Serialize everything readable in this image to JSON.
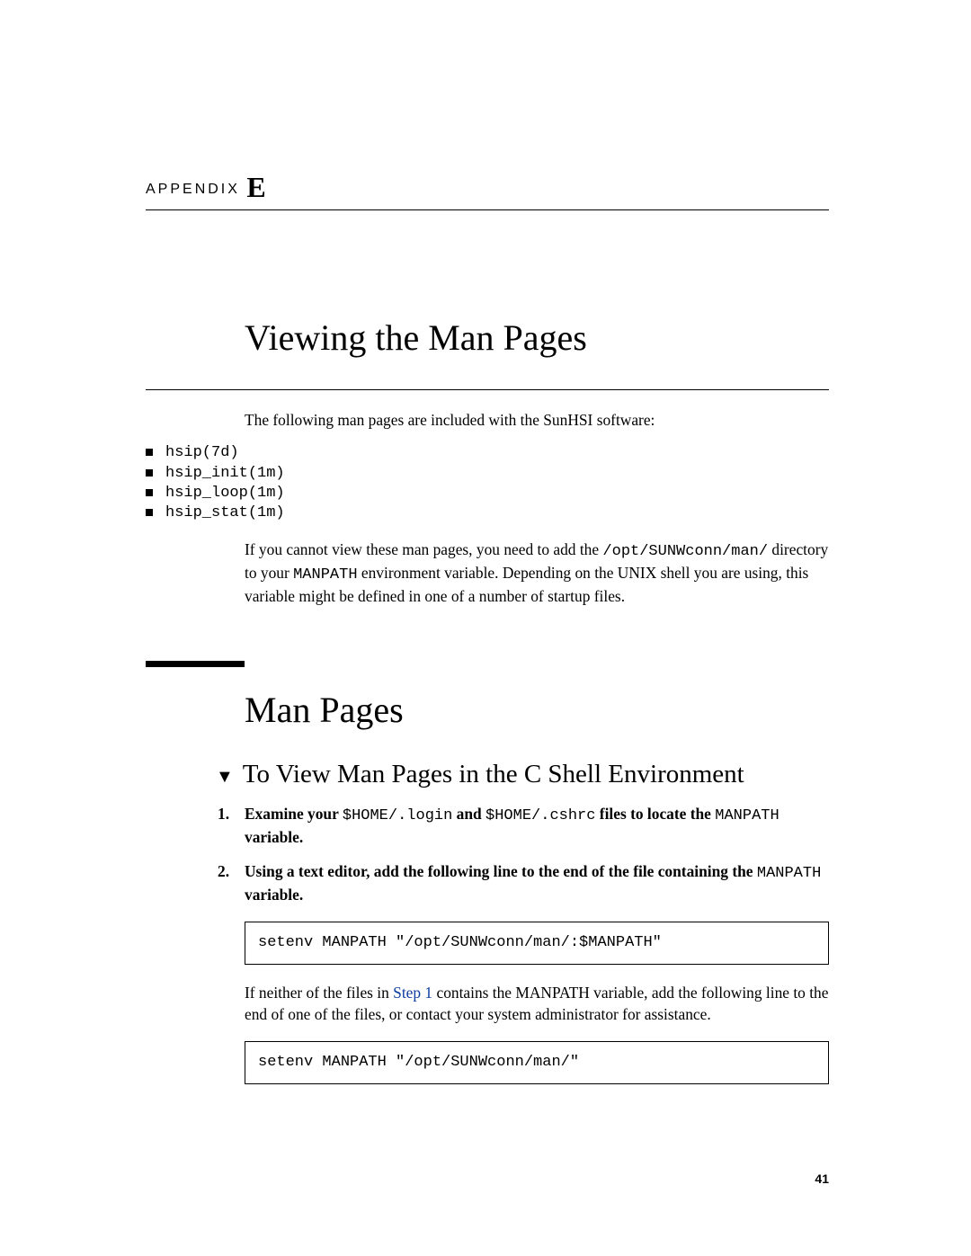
{
  "appendix": {
    "label": "APPENDIX",
    "letter": "E"
  },
  "title": "Viewing the Man Pages",
  "intro": "The following man pages are included with the SunHSI software:",
  "bullets": [
    "hsip(7d)",
    "hsip_init(1m)",
    "hsip_loop(1m)",
    "hsip_stat(1m)"
  ],
  "para2_a": "If you cannot view these man pages, you need to add the ",
  "para2_code": "/opt/SUNWconn/man/",
  "para2_b": " directory to your ",
  "para2_sc": "MANPATH",
  "para2_c": " environment variable. Depending on the UNIX shell you are using, this variable might be defined in one of a number of startup files.",
  "section": "Man Pages",
  "sub": {
    "marker": "▼",
    "title": "To View Man Pages in the C Shell Environment"
  },
  "step1": {
    "num": "1.",
    "a": "Examine your ",
    "code1": "$HOME/.login",
    "b": " and ",
    "code2": "$HOME/.cshrc",
    "c": " files to locate the ",
    "sc": "MANPATH",
    "d": " variable."
  },
  "step2": {
    "num": "2.",
    "a": "Using a text editor, add the following line to the end of the file containing the ",
    "sc": "MANPATH",
    "b": " variable."
  },
  "code1": "setenv MANPATH \"/opt/SUNWconn/man/:$MANPATH\"",
  "after": {
    "a": "If neither of the files in ",
    "link": "Step 1",
    "b": " contains the MANPATH variable, add the following line to the end of one of the files, or contact your system administrator for assistance."
  },
  "code2": "setenv MANPATH \"/opt/SUNWconn/man/\"",
  "pagenum": "41"
}
